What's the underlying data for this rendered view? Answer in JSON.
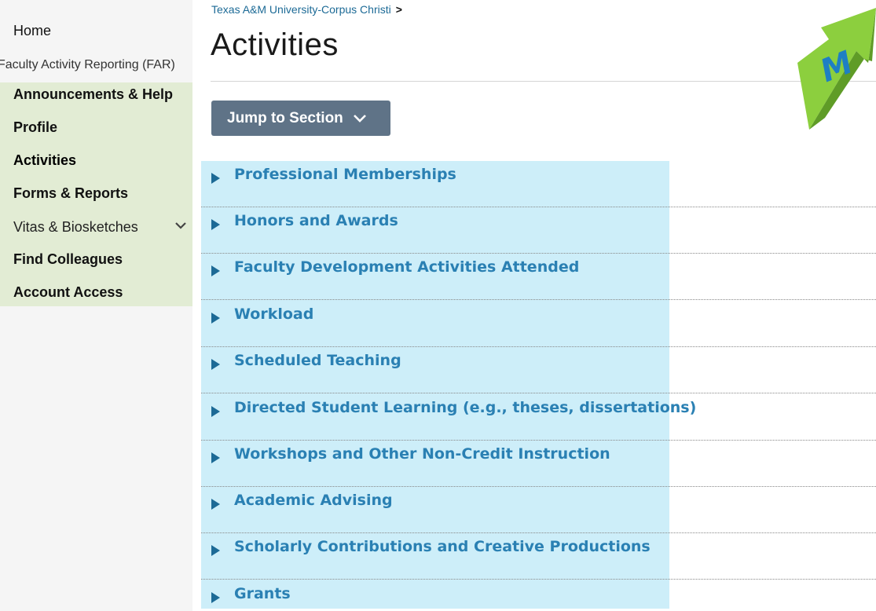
{
  "sidebar": {
    "home": "Home",
    "far": "Faculty Activity Reporting (FAR)",
    "items": [
      {
        "label": "Announcements & Help"
      },
      {
        "label": "Profile"
      },
      {
        "label": "Activities"
      },
      {
        "label": "Forms & Reports"
      },
      {
        "label": "Vitas & Biosketches"
      },
      {
        "label": "Find Colleagues"
      },
      {
        "label": "Account Access"
      }
    ]
  },
  "header": {
    "breadcrumb": "Texas A&M University-Corpus Christi",
    "breadcrumb_sep": ">",
    "title": "Activities"
  },
  "jump": {
    "label": "Jump to Section"
  },
  "logo": {
    "letter": "M"
  },
  "sections": [
    {
      "label": "Professional Memberships"
    },
    {
      "label": "Honors and Awards"
    },
    {
      "label": "Faculty Development Activities Attended"
    },
    {
      "label": "Workload"
    },
    {
      "label": "Scheduled Teaching"
    },
    {
      "label": "Directed Student Learning (e.g., theses, dissertations)"
    },
    {
      "label": "Workshops and Other Non-Credit Instruction"
    },
    {
      "label": "Academic Advising"
    },
    {
      "label": "Scholarly Contributions and Creative Productions"
    },
    {
      "label": "Grants"
    }
  ],
  "colors": {
    "accent": "#2a80b3",
    "sidebar_highlight": "#e2ecd4",
    "section_highlight": "#cdeef9",
    "button": "#5f7387"
  }
}
